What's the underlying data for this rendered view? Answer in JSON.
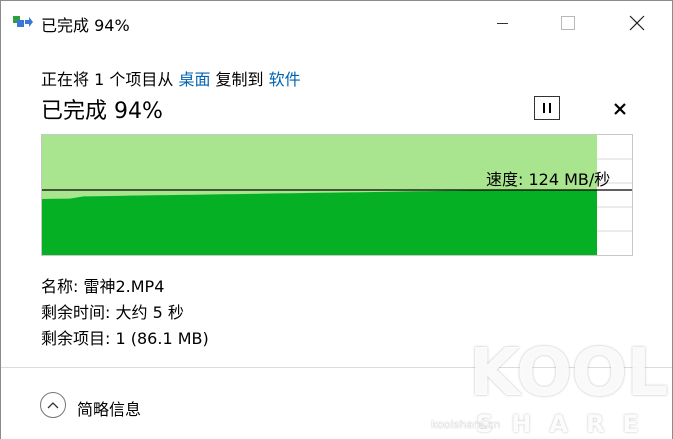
{
  "window": {
    "title": "已完成 94%",
    "colors": {
      "graph_fill": "#06b025",
      "graph_bg": "#a8e58e",
      "link": "#0063b1"
    }
  },
  "operation": {
    "desc_prefix": "正在将 1 个项目从 ",
    "source": "桌面",
    "desc_middle": " 复制到 ",
    "destination": "软件"
  },
  "progress": {
    "headline": "已完成 94%",
    "percent": 94,
    "speed_text": "速度: 124 MB/秒"
  },
  "details": {
    "name_label": "名称: ",
    "name_value": "雷神2.MP4",
    "time_label": "剩余时间: ",
    "time_value": "大约 5 秒",
    "items_label": "剩余项目: ",
    "items_value": "1 (86.1 MB)"
  },
  "footer": {
    "less_info_label": "简略信息"
  },
  "watermark": {
    "brand": "KOOL",
    "sub": "SHARE",
    "url": "koolshare.cn"
  }
}
